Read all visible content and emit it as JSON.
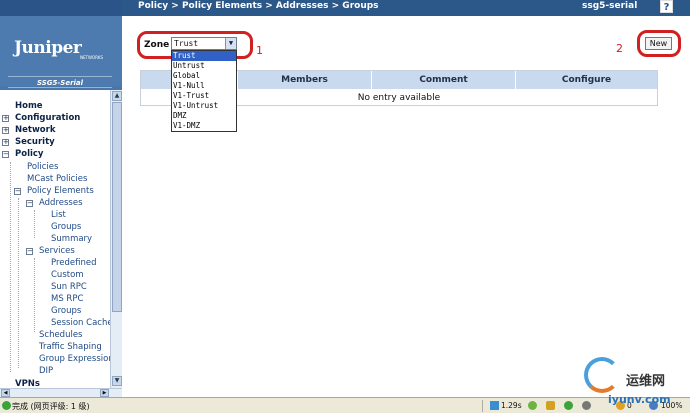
{
  "header": {
    "breadcrumb": "Policy > Policy Elements > Addresses > Groups",
    "device_name": "ssg5-serial",
    "help_label": "?"
  },
  "brand": {
    "logo_text": "Juniper",
    "logo_subtext": "NETWORKS",
    "model": "SSG5-Serial"
  },
  "nav": {
    "home": "Home",
    "configuration": "Configuration",
    "network": "Network",
    "security": "Security",
    "policy": "Policy",
    "policies": "Policies",
    "mcast_policies": "MCast Policies",
    "policy_elements": "Policy Elements",
    "addresses": "Addresses",
    "list": "List",
    "groups": "Groups",
    "summary": "Summary",
    "services": "Services",
    "predefined": "Predefined",
    "custom": "Custom",
    "sun_rpc": "Sun RPC",
    "ms_rpc": "MS RPC",
    "svc_groups": "Groups",
    "session_cache": "Session Cache",
    "schedules": "Schedules",
    "traffic_shaping": "Traffic Shaping",
    "group_expressions": "Group Expressions",
    "dip": "DIP",
    "vpns": "VPNs"
  },
  "zone": {
    "label": "Zone",
    "selected": "Trust",
    "options": [
      "Trust",
      "Untrust",
      "Global",
      "V1-Null",
      "V1-Trust",
      "V1-Untrust",
      "DMZ",
      "V1-DMZ"
    ]
  },
  "annotations": {
    "one": "1",
    "two": "2"
  },
  "new_button": "New",
  "table": {
    "columns": [
      "",
      "Members",
      "Comment",
      "Configure"
    ],
    "empty_text": "No entry available"
  },
  "statusbar": {
    "text": "完成 (网页评级: 1 级)",
    "time": "1.29s",
    "count": "0",
    "zoom": "100%"
  },
  "watermark": {
    "cn": "运维网",
    "url": "iyunv.com"
  },
  "colors": {
    "header_bg": "#2c5789",
    "sidebar_bg": "#4a77aa",
    "table_header_bg": "#c9d9ee",
    "selected_option": "#3161c7",
    "annotation_red": "#d02020"
  }
}
